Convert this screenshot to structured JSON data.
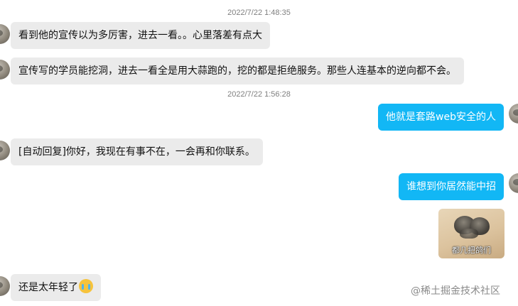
{
  "timestamps": [
    "2022/7/22 1:48:35",
    "2022/7/22 1:56:28"
  ],
  "messages": [
    {
      "direction": "received",
      "text": "看到他的宣传以为多厉害，进去一看。。心里落差有点大"
    },
    {
      "direction": "received",
      "text": "宣传写的学员能挖洞，进去一看全是用大蒜跑的，挖的都是拒绝服务。那些人连基本的逆向都不会。"
    },
    {
      "direction": "sent",
      "text": "他就是套路web安全的人"
    },
    {
      "direction": "received",
      "text": "[自动回复]你好，我现在有事不在，一会再和你联系。"
    },
    {
      "direction": "sent",
      "text": "谁想到你居然能中招"
    },
    {
      "direction": "sent",
      "type": "sticker",
      "caption": "都几把鸽们",
      "icon": "pigeons-sticker"
    },
    {
      "direction": "received",
      "text": "还是太年轻了",
      "emoji": "crying-face-emoji"
    }
  ],
  "watermark": "@稀土掘金技术社区",
  "colors": {
    "sent_bubble": "#12b7f5",
    "received_bubble": "#ebebeb"
  }
}
